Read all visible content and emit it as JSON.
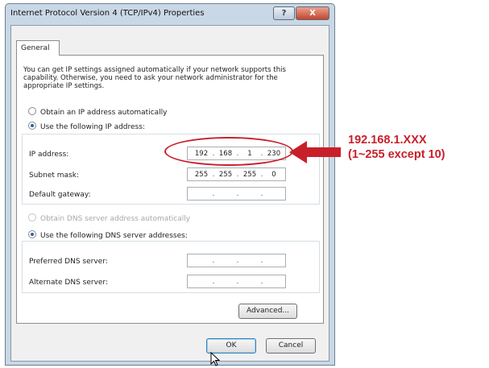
{
  "window": {
    "title": "Internet Protocol Version 4 (TCP/IPv4) Properties",
    "help_label": "?",
    "close_label": "X"
  },
  "tabs": [
    {
      "label": "General",
      "selected": true
    }
  ],
  "description": "You can get IP settings assigned automatically if your network supports this capability. Otherwise, you need to ask your network administrator for the appropriate IP settings.",
  "ip_section": {
    "auto_label": "Obtain an IP address automatically",
    "manual_label": "Use the following IP address:",
    "selected": "manual",
    "ip_address": {
      "label": "IP address:",
      "octets": [
        "192",
        "168",
        "1",
        "230"
      ]
    },
    "subnet_mask": {
      "label": "Subnet mask:",
      "octets": [
        "255",
        "255",
        "255",
        "0"
      ]
    },
    "default_gateway": {
      "label": "Default gateway:",
      "octets": [
        "",
        "",
        "",
        ""
      ]
    }
  },
  "dns_section": {
    "auto_label": "Obtain DNS server address automatically",
    "manual_label": "Use the following DNS server addresses:",
    "selected": "manual",
    "auto_disabled": true,
    "preferred": {
      "label": "Preferred DNS server:",
      "octets": [
        "",
        "",
        "",
        ""
      ]
    },
    "alternate": {
      "label": "Alternate DNS server:",
      "octets": [
        "",
        "",
        "",
        ""
      ]
    }
  },
  "buttons": {
    "advanced": "Advanced...",
    "ok": "OK",
    "cancel": "Cancel"
  },
  "annotation": {
    "line1": "192.168.1.XXX",
    "line2": "(1~255 except 10)",
    "color": "#c8202a"
  }
}
